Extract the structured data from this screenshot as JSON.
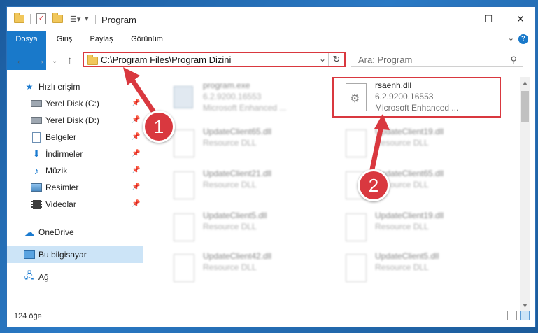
{
  "window": {
    "title": "Program",
    "controls": {
      "minimize": "—",
      "maximize": "☐",
      "close": "✕"
    }
  },
  "ribbon": {
    "tabs": [
      "Dosya",
      "Giriş",
      "Paylaş",
      "Görünüm"
    ],
    "help_label": "?"
  },
  "address": {
    "path": "C:\\Program Files\\Program Dizini",
    "search_placeholder": "Ara: Program"
  },
  "sidebar": {
    "items": [
      {
        "label": "Hızlı erişim",
        "icon": "star-icon"
      },
      {
        "label": "Yerel Disk (C:)",
        "icon": "drive-icon"
      },
      {
        "label": "Yerel Disk (D:)",
        "icon": "drive-icon"
      },
      {
        "label": "Belgeler",
        "icon": "documents-icon"
      },
      {
        "label": "İndirmeler",
        "icon": "download-icon"
      },
      {
        "label": "Müzik",
        "icon": "music-icon"
      },
      {
        "label": "Resimler",
        "icon": "pictures-icon"
      },
      {
        "label": "Videolar",
        "icon": "video-icon"
      },
      {
        "label": "OneDrive",
        "icon": "cloud-icon"
      },
      {
        "label": "Bu bilgisayar",
        "icon": "computer-icon"
      },
      {
        "label": "Ağ",
        "icon": "network-icon"
      }
    ],
    "selected": "Bu bilgisayar"
  },
  "files": [
    {
      "name": "program.exe",
      "line1": "6.2.9200.16553",
      "line2": "Microsoft Enhanced ...",
      "type": "exe"
    },
    {
      "name": "rsaenh.dll",
      "line1": "6.2.9200.16553",
      "line2": "Microsoft Enhanced ...",
      "type": "dll",
      "highlighted": true
    },
    {
      "name": "UpdateClient65.dll",
      "line1": "Resource DLL",
      "type": "dll"
    },
    {
      "name": "UpdateClient19.dll",
      "line1": "Resource DLL",
      "type": "dll"
    },
    {
      "name": "UpdateClient21.dll",
      "line1": "Resource DLL",
      "type": "dll"
    },
    {
      "name": "UpdateClient65.dll",
      "line1": "Resource DLL",
      "type": "dll"
    },
    {
      "name": "UpdateClient5.dll",
      "line1": "Resource DLL",
      "type": "dll"
    },
    {
      "name": "UpdateClient19.dll",
      "line1": "Resource DLL",
      "type": "dll"
    },
    {
      "name": "UpdateClient42.dll",
      "line1": "Resource DLL",
      "type": "dll"
    },
    {
      "name": "UpdateClient5.dll",
      "line1": "Resource DLL",
      "type": "dll"
    }
  ],
  "status": {
    "count": "124 öğe"
  },
  "annotations": {
    "step1": "1",
    "step2": "2",
    "color": "#d9383f"
  }
}
